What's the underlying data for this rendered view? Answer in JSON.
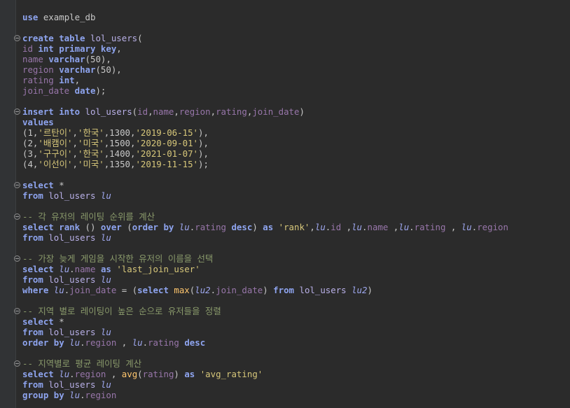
{
  "editor": {
    "lines": [
      {
        "fold": false,
        "tokens": [
          [
            "kw",
            "use"
          ],
          [
            "plain",
            " example_db"
          ]
        ]
      },
      {
        "fold": false,
        "tokens": []
      },
      {
        "fold": true,
        "tokens": [
          [
            "kw",
            "create table"
          ],
          [
            "plain",
            " "
          ],
          [
            "tbl",
            "lol_users"
          ],
          [
            "plain",
            "("
          ]
        ]
      },
      {
        "fold": false,
        "tokens": [
          [
            "col",
            "id"
          ],
          [
            "plain",
            " "
          ],
          [
            "kw",
            "int primary key"
          ],
          [
            "plain",
            ","
          ]
        ]
      },
      {
        "fold": false,
        "tokens": [
          [
            "col",
            "name"
          ],
          [
            "plain",
            " "
          ],
          [
            "kw",
            "varchar"
          ],
          [
            "plain",
            "(50),"
          ]
        ]
      },
      {
        "fold": false,
        "tokens": [
          [
            "col",
            "region"
          ],
          [
            "plain",
            " "
          ],
          [
            "kw",
            "varchar"
          ],
          [
            "plain",
            "(50),"
          ]
        ]
      },
      {
        "fold": false,
        "tokens": [
          [
            "col",
            "rating"
          ],
          [
            "plain",
            " "
          ],
          [
            "kw",
            "int"
          ],
          [
            "plain",
            ","
          ]
        ]
      },
      {
        "fold": false,
        "tokens": [
          [
            "col",
            "join_date"
          ],
          [
            "plain",
            " "
          ],
          [
            "kw",
            "date"
          ],
          [
            "plain",
            ");"
          ]
        ]
      },
      {
        "fold": false,
        "tokens": []
      },
      {
        "fold": true,
        "tokens": [
          [
            "kw",
            "insert into"
          ],
          [
            "plain",
            " "
          ],
          [
            "tbl",
            "lol_users"
          ],
          [
            "plain",
            "("
          ],
          [
            "col",
            "id"
          ],
          [
            "plain",
            ","
          ],
          [
            "col",
            "name"
          ],
          [
            "plain",
            ","
          ],
          [
            "col",
            "region"
          ],
          [
            "plain",
            ","
          ],
          [
            "col",
            "rating"
          ],
          [
            "plain",
            ","
          ],
          [
            "col",
            "join_date"
          ],
          [
            "plain",
            ")"
          ]
        ]
      },
      {
        "fold": false,
        "tokens": [
          [
            "kw",
            "values"
          ]
        ]
      },
      {
        "fold": false,
        "tokens": [
          [
            "plain",
            "(1,"
          ],
          [
            "str",
            "'르탄이'"
          ],
          [
            "plain",
            ","
          ],
          [
            "str",
            "'한국'"
          ],
          [
            "plain",
            ",1300,"
          ],
          [
            "str",
            "'2019-06-15'"
          ],
          [
            "plain",
            "),"
          ]
        ]
      },
      {
        "fold": false,
        "tokens": [
          [
            "plain",
            "(2,"
          ],
          [
            "str",
            "'배캠이'"
          ],
          [
            "plain",
            ","
          ],
          [
            "str",
            "'미국'"
          ],
          [
            "plain",
            ",1500,"
          ],
          [
            "str",
            "'2020-09-01'"
          ],
          [
            "plain",
            "),"
          ]
        ]
      },
      {
        "fold": false,
        "tokens": [
          [
            "plain",
            "(3,"
          ],
          [
            "str",
            "'구구이'"
          ],
          [
            "plain",
            ","
          ],
          [
            "str",
            "'한국'"
          ],
          [
            "plain",
            ",1400,"
          ],
          [
            "str",
            "'2021-01-07'"
          ],
          [
            "plain",
            "),"
          ]
        ]
      },
      {
        "fold": false,
        "tokens": [
          [
            "plain",
            "(4,"
          ],
          [
            "str",
            "'이선이'"
          ],
          [
            "plain",
            ","
          ],
          [
            "str",
            "'미국'"
          ],
          [
            "plain",
            ",1350,"
          ],
          [
            "str",
            "'2019-11-15'"
          ],
          [
            "plain",
            ");"
          ]
        ]
      },
      {
        "fold": false,
        "tokens": []
      },
      {
        "fold": true,
        "tokens": [
          [
            "kw",
            "select"
          ],
          [
            "plain",
            " *"
          ]
        ]
      },
      {
        "fold": false,
        "tokens": [
          [
            "kw",
            "from"
          ],
          [
            "plain",
            " "
          ],
          [
            "tbl",
            "lol_users"
          ],
          [
            "plain",
            " "
          ],
          [
            "alias",
            "lu"
          ]
        ]
      },
      {
        "fold": false,
        "tokens": []
      },
      {
        "fold": true,
        "tokens": [
          [
            "cmt",
            "-- 각 유저의 레이팅 순위를 계산"
          ]
        ]
      },
      {
        "fold": false,
        "tokens": [
          [
            "kw",
            "select"
          ],
          [
            "plain",
            " "
          ],
          [
            "kw",
            "rank"
          ],
          [
            "plain",
            " () "
          ],
          [
            "kw",
            "over"
          ],
          [
            "plain",
            " ("
          ],
          [
            "kw",
            "order by"
          ],
          [
            "plain",
            " "
          ],
          [
            "alias",
            "lu"
          ],
          [
            "plain",
            "."
          ],
          [
            "col",
            "rating"
          ],
          [
            "plain",
            " "
          ],
          [
            "kw",
            "desc"
          ],
          [
            "plain",
            ") "
          ],
          [
            "kw",
            "as"
          ],
          [
            "plain",
            " "
          ],
          [
            "str",
            "'rank'"
          ],
          [
            "plain",
            ","
          ],
          [
            "alias",
            "lu"
          ],
          [
            "plain",
            "."
          ],
          [
            "col",
            "id"
          ],
          [
            "plain",
            " ,"
          ],
          [
            "alias",
            "lu"
          ],
          [
            "plain",
            "."
          ],
          [
            "col",
            "name"
          ],
          [
            "plain",
            " ,"
          ],
          [
            "alias",
            "lu"
          ],
          [
            "plain",
            "."
          ],
          [
            "col",
            "rating"
          ],
          [
            "plain",
            " , "
          ],
          [
            "alias",
            "lu"
          ],
          [
            "plain",
            "."
          ],
          [
            "col",
            "region"
          ]
        ]
      },
      {
        "fold": false,
        "tokens": [
          [
            "kw",
            "from"
          ],
          [
            "plain",
            " "
          ],
          [
            "tbl",
            "lol_users"
          ],
          [
            "plain",
            " "
          ],
          [
            "alias",
            "lu"
          ]
        ]
      },
      {
        "fold": false,
        "tokens": []
      },
      {
        "fold": true,
        "tokens": [
          [
            "cmt",
            "-- 가장 늦게 게임을 시작한 유저의 이름을 선택"
          ]
        ]
      },
      {
        "fold": false,
        "tokens": [
          [
            "kw",
            "select"
          ],
          [
            "plain",
            " "
          ],
          [
            "alias",
            "lu"
          ],
          [
            "plain",
            "."
          ],
          [
            "col",
            "name"
          ],
          [
            "plain",
            " "
          ],
          [
            "kw",
            "as"
          ],
          [
            "plain",
            " "
          ],
          [
            "str",
            "'last_join_user'"
          ]
        ]
      },
      {
        "fold": false,
        "tokens": [
          [
            "kw",
            "from"
          ],
          [
            "plain",
            " "
          ],
          [
            "tbl",
            "lol_users"
          ],
          [
            "plain",
            " "
          ],
          [
            "alias",
            "lu"
          ]
        ]
      },
      {
        "fold": false,
        "tokens": [
          [
            "kw",
            "where"
          ],
          [
            "plain",
            " "
          ],
          [
            "alias",
            "lu"
          ],
          [
            "plain",
            "."
          ],
          [
            "col",
            "join_date"
          ],
          [
            "plain",
            " = ("
          ],
          [
            "kw",
            "select"
          ],
          [
            "plain",
            " "
          ],
          [
            "fn",
            "max"
          ],
          [
            "plain",
            "("
          ],
          [
            "alias",
            "lu2"
          ],
          [
            "plain",
            "."
          ],
          [
            "col",
            "join_date"
          ],
          [
            "plain",
            ") "
          ],
          [
            "kw",
            "from"
          ],
          [
            "plain",
            " "
          ],
          [
            "tbl",
            "lol_users"
          ],
          [
            "plain",
            " "
          ],
          [
            "alias",
            "lu2"
          ],
          [
            "plain",
            ")"
          ]
        ]
      },
      {
        "fold": false,
        "tokens": []
      },
      {
        "fold": true,
        "tokens": [
          [
            "cmt",
            "-- 지역 별로 레이팅이 높은 순으로 유저들을 정렬"
          ]
        ]
      },
      {
        "fold": false,
        "tokens": [
          [
            "kw",
            "select"
          ],
          [
            "plain",
            " *"
          ]
        ]
      },
      {
        "fold": false,
        "tokens": [
          [
            "kw",
            "from"
          ],
          [
            "plain",
            " "
          ],
          [
            "tbl",
            "lol_users"
          ],
          [
            "plain",
            " "
          ],
          [
            "alias",
            "lu"
          ]
        ]
      },
      {
        "fold": false,
        "tokens": [
          [
            "kw",
            "order by"
          ],
          [
            "plain",
            " "
          ],
          [
            "alias",
            "lu"
          ],
          [
            "plain",
            "."
          ],
          [
            "col",
            "region"
          ],
          [
            "plain",
            " , "
          ],
          [
            "alias",
            "lu"
          ],
          [
            "plain",
            "."
          ],
          [
            "col",
            "rating"
          ],
          [
            "plain",
            " "
          ],
          [
            "kw",
            "desc"
          ]
        ]
      },
      {
        "fold": false,
        "tokens": []
      },
      {
        "fold": true,
        "tokens": [
          [
            "cmt",
            "-- 지역별로 평균 레이팅 계산"
          ]
        ]
      },
      {
        "fold": false,
        "tokens": [
          [
            "kw",
            "select"
          ],
          [
            "plain",
            " "
          ],
          [
            "alias",
            "lu"
          ],
          [
            "plain",
            "."
          ],
          [
            "col",
            "region"
          ],
          [
            "plain",
            " , "
          ],
          [
            "fn",
            "avg"
          ],
          [
            "plain",
            "("
          ],
          [
            "col",
            "rating"
          ],
          [
            "plain",
            ") "
          ],
          [
            "kw",
            "as"
          ],
          [
            "plain",
            " "
          ],
          [
            "str",
            "'avg_rating'"
          ]
        ]
      },
      {
        "fold": false,
        "tokens": [
          [
            "kw",
            "from"
          ],
          [
            "plain",
            " "
          ],
          [
            "tbl",
            "lol_users"
          ],
          [
            "plain",
            " "
          ],
          [
            "alias",
            "lu"
          ]
        ]
      },
      {
        "fold": false,
        "tokens": [
          [
            "kw",
            "group by"
          ],
          [
            "plain",
            " "
          ],
          [
            "alias",
            "lu"
          ],
          [
            "plain",
            "."
          ],
          [
            "col",
            "region"
          ]
        ]
      }
    ]
  },
  "colors": {
    "background": "#2b2b2b",
    "gutter": "#313335",
    "keyword": "#8ea4ef",
    "column": "#9876aa",
    "string": "#d7c77a",
    "comment": "#8a9a6b",
    "function": "#ffc66d"
  },
  "icons": {
    "fold": "fold-marker-icon"
  }
}
